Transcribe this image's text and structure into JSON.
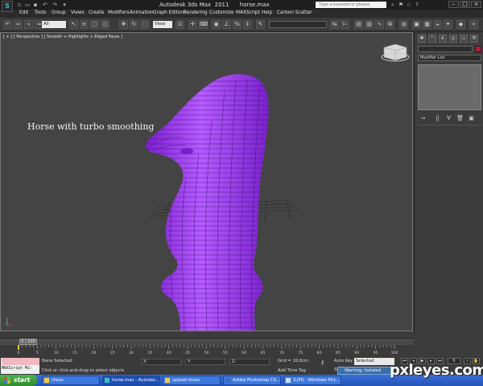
{
  "titlebar": {
    "title": "Autodesk 3ds Max  2011      horse.max",
    "search_placeholder": "Type a keyword or phrase",
    "logo_glyph": "S"
  },
  "menu": [
    "Edit",
    "Tools",
    "Group",
    "Views",
    "Create",
    "Modifiers",
    "Animation",
    "Graph Editors",
    "Rendering",
    "Customize",
    "MAXScript",
    "Help",
    "Carbon Scatter"
  ],
  "toolbar": {
    "selection_filter": "All",
    "reference_coord": "View"
  },
  "viewport": {
    "label": "[ + ] [ Perspective ] [ Smooth + Highlights + Edged Faces ]",
    "annotation": "Horse with turbo smoothing",
    "model_color": "#9b30f0",
    "background_color": "#444444"
  },
  "command_panel": {
    "modifier_list": "Modifier List",
    "color_swatch": "#b81a3a"
  },
  "timeline": {
    "position": "0 / 100",
    "current_frame": 0,
    "total_frames": 100,
    "ticks": [
      "0",
      "5",
      "10",
      "15",
      "20",
      "25",
      "30",
      "35",
      "40",
      "45",
      "50",
      "55",
      "60",
      "65",
      "70",
      "75",
      "80",
      "85",
      "90",
      "95",
      "100"
    ]
  },
  "statusbar": {
    "maxscript_label": "MAXScript Mi:",
    "selection": "None Selected",
    "prompt": "Click or click-and-drag to select objects",
    "x_label": "X:",
    "y_label": "Y:",
    "z_label": "Z:",
    "grid": "Grid = 10,0cm",
    "add_time_tag": "Add Time Tag",
    "auto_key": "Auto Key",
    "key_filter": "Selected",
    "set_key": "Set K",
    "warning": "Warning: Isolated"
  },
  "taskbar": {
    "start": "start",
    "items": [
      "chess",
      "horse.max - Autodes...",
      "upload chess",
      "Adobe Photoshop CS...",
      "3.JPG - Windows Pict..."
    ]
  },
  "watermark": "pxleyes.com"
}
